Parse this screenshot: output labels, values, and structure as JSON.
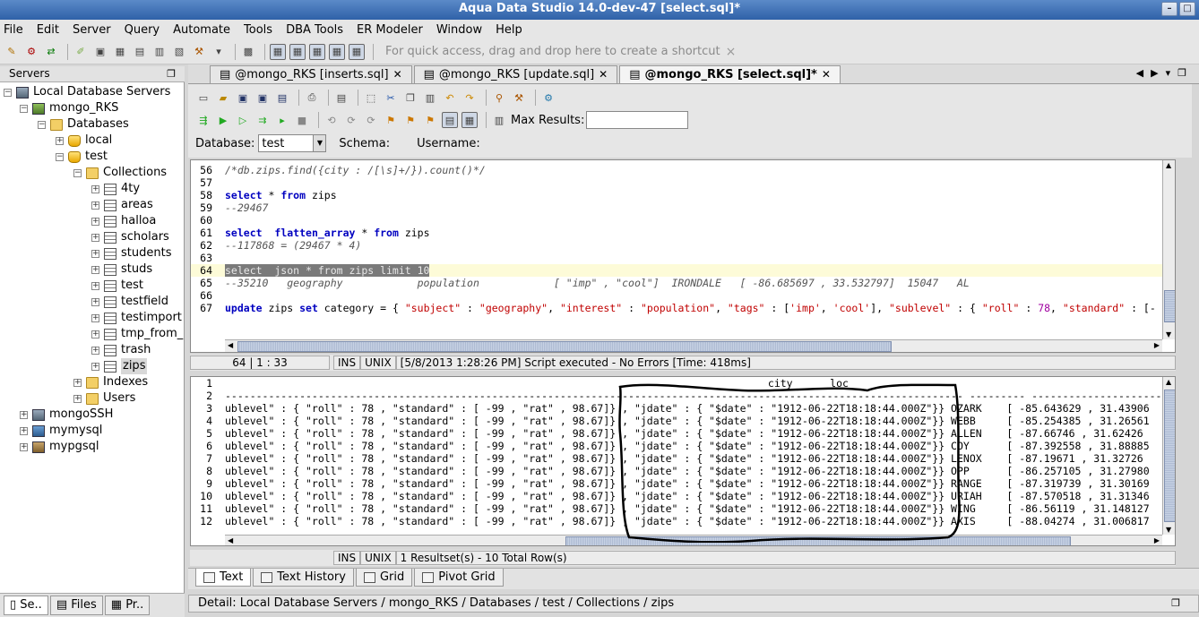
{
  "window": {
    "title": "Aqua Data Studio 14.0-dev-47 [select.sql]*"
  },
  "menu": [
    "File",
    "Edit",
    "Server",
    "Query",
    "Automate",
    "Tools",
    "DBA Tools",
    "ER Modeler",
    "Window",
    "Help"
  ],
  "toolbar": {
    "shortcut_hint": "For quick access, drag and drop here to create a shortcut",
    "close_x": "×"
  },
  "servers_panel": {
    "title": "Servers",
    "tree": [
      {
        "label": "Local Database Servers",
        "icon": "server-group-icon"
      },
      {
        "label": "mongo_RKS",
        "icon": "mongo-server-icon"
      },
      {
        "label": "Databases",
        "icon": "folder-icon"
      },
      {
        "label": "local",
        "icon": "database-icon"
      },
      {
        "label": "test",
        "icon": "database-icon"
      },
      {
        "label": "Collections",
        "icon": "folder-icon"
      },
      {
        "label": "4ty",
        "icon": "table-icon"
      },
      {
        "label": "areas",
        "icon": "table-icon"
      },
      {
        "label": "halloa",
        "icon": "table-icon"
      },
      {
        "label": "scholars",
        "icon": "table-icon"
      },
      {
        "label": "students",
        "icon": "table-icon"
      },
      {
        "label": "studs",
        "icon": "table-icon"
      },
      {
        "label": "test",
        "icon": "table-icon"
      },
      {
        "label": "testfield",
        "icon": "table-icon"
      },
      {
        "label": "testimport",
        "icon": "table-icon"
      },
      {
        "label": "tmp_from_",
        "icon": "table-icon"
      },
      {
        "label": "trash",
        "icon": "table-icon"
      },
      {
        "label": "zips",
        "icon": "table-icon"
      },
      {
        "label": "Indexes",
        "icon": "folder-icon"
      },
      {
        "label": "Users",
        "icon": "folder-icon"
      },
      {
        "label": "mongoSSH",
        "icon": "server-icon"
      },
      {
        "label": "mymysql",
        "icon": "mysql-server-icon"
      },
      {
        "label": "mypgsql",
        "icon": "pgsql-server-icon"
      }
    ],
    "bottom_tabs": [
      "Se..",
      "Files",
      "Pr.."
    ]
  },
  "doc_tabs": [
    {
      "label": "@mongo_RKS [inserts.sql]",
      "active": false
    },
    {
      "label": "@mongo_RKS [update.sql]",
      "active": false
    },
    {
      "label": "@mongo_RKS [select.sql]*",
      "active": true
    }
  ],
  "editor_toolbar": {
    "max_results_label": "Max Results:",
    "max_results_value": "",
    "database_label": "Database:",
    "database_value": "test",
    "schema_label": "Schema:",
    "username_label": "Username:"
  },
  "editor": {
    "lines": [
      {
        "n": "56",
        "text": "/*db.zips.find({city : /[\\s]+/}).count()*/"
      },
      {
        "n": "57",
        "text": ""
      },
      {
        "n": "58",
        "text": "select * from zips"
      },
      {
        "n": "59",
        "text": "--29467"
      },
      {
        "n": "60",
        "text": ""
      },
      {
        "n": "61",
        "text": "select  flatten_array * from zips"
      },
      {
        "n": "62",
        "text": "--117868 = (29467 * 4)"
      },
      {
        "n": "63",
        "text": ""
      },
      {
        "n": "64",
        "text": "select  json * from zips limit 10"
      },
      {
        "n": "65",
        "text": "--35210   geography            population            [ \"imp\" , \"cool\"]  IRONDALE   [ -86.685697 , 33.532797]  15047   AL"
      },
      {
        "n": "66",
        "text": ""
      },
      {
        "n": "67",
        "text": "update zips set category = { \"subject\" : \"geography\", \"interest\" : \"population\", \"tags\" : ['imp', 'cool'], \"sublevel\" : { \"roll\" : 78, \"standard\" : [-"
      }
    ],
    "status": {
      "position": "64 | 1 : 33",
      "ins": "INS",
      "eol": "UNIX",
      "message": "[5/8/2013 1:28:26 PM] Script executed - No Errors [Time: 418ms]"
    }
  },
  "results": {
    "header_line": "                                                                                                                       city      loc",
    "dash_line": "----------------------------------------------------------------------------------------------------------------------- --------- -----------------------",
    "rows": [
      {
        "n": "3",
        "text": "ublevel\" : { \"roll\" : 78 , \"standard\" : [ -99 , \"rat\" , 98.67]} , \"jdate\" : { \"$date\" : \"1912-06-22T18:18:44.000Z\"}} OZARK    [ -85.643629 , 31.43906"
      },
      {
        "n": "4",
        "text": "ublevel\" : { \"roll\" : 78 , \"standard\" : [ -99 , \"rat\" , 98.67]} , \"jdate\" : { \"$date\" : \"1912-06-22T18:18:44.000Z\"}} WEBB     [ -85.254385 , 31.26561"
      },
      {
        "n": "5",
        "text": "ublevel\" : { \"roll\" : 78 , \"standard\" : [ -99 , \"rat\" , 98.67]} , \"jdate\" : { \"$date\" : \"1912-06-22T18:18:44.000Z\"}} ALLEN    [ -87.66746 , 31.62426"
      },
      {
        "n": "6",
        "text": "ublevel\" : { \"roll\" : 78 , \"standard\" : [ -99 , \"rat\" , 98.67]} , \"jdate\" : { \"$date\" : \"1912-06-22T18:18:44.000Z\"}} COY      [ -87.392558 , 31.88885"
      },
      {
        "n": "7",
        "text": "ublevel\" : { \"roll\" : 78 , \"standard\" : [ -99 , \"rat\" , 98.67]} , \"jdate\" : { \"$date\" : \"1912-06-22T18:18:44.000Z\"}} LENOX    [ -87.19671 , 31.32726"
      },
      {
        "n": "8",
        "text": "ublevel\" : { \"roll\" : 78 , \"standard\" : [ -99 , \"rat\" , 98.67]} , \"jdate\" : { \"$date\" : \"1912-06-22T18:18:44.000Z\"}} OPP      [ -86.257105 , 31.27980"
      },
      {
        "n": "9",
        "text": "ublevel\" : { \"roll\" : 78 , \"standard\" : [ -99 , \"rat\" , 98.67]} , \"jdate\" : { \"$date\" : \"1912-06-22T18:18:44.000Z\"}} RANGE    [ -87.319739 , 31.30169"
      },
      {
        "n": "10",
        "text": "ublevel\" : { \"roll\" : 78 , \"standard\" : [ -99 , \"rat\" , 98.67]} , \"jdate\" : { \"$date\" : \"1912-06-22T18:18:44.000Z\"}} URIAH    [ -87.570518 , 31.31346"
      },
      {
        "n": "11",
        "text": "ublevel\" : { \"roll\" : 78 , \"standard\" : [ -99 , \"rat\" , 98.67]} , \"jdate\" : { \"$date\" : \"1912-06-22T18:18:44.000Z\"}} WING     [ -86.56119 , 31.148127"
      },
      {
        "n": "12",
        "text": "ublevel\" : { \"roll\" : 78 , \"standard\" : [ -99 , \"rat\" , 98.67]} , \"jdate\" : { \"$date\" : \"1912-06-22T18:18:44.000Z\"}} AXIS     [ -88.04274 , 31.006817"
      }
    ],
    "status": {
      "ins": "INS",
      "eol": "UNIX",
      "message": "1 Resultset(s) - 10 Total Row(s)"
    },
    "tabs": [
      "Text",
      "Text History",
      "Grid",
      "Pivot Grid"
    ]
  },
  "detail": "Detail: Local Database Servers / mongo_RKS / Databases / test / Collections / zips"
}
